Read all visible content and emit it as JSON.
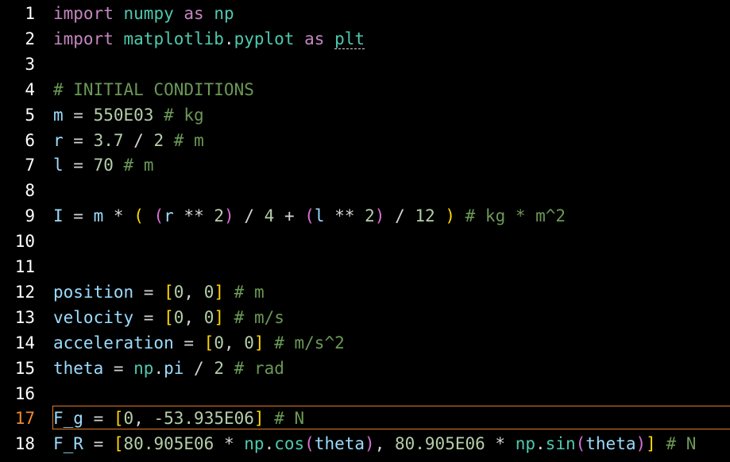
{
  "editor": {
    "language": "python",
    "active_line": 17,
    "colors": {
      "background": "#000000",
      "line_number": "#ffffff",
      "active_line_number": "#f08a30",
      "current_line_border": "#e07b2a",
      "keyword": "#c586c0",
      "module": "#4ec9b0",
      "variable": "#9cdcfe",
      "number": "#b5cea8",
      "comment": "#6a9955",
      "bracket_level1": "#ffd700",
      "bracket_level2": "#da70d6"
    },
    "lines": [
      {
        "n": "1",
        "tokens": [
          [
            "kw",
            "import"
          ],
          [
            "op",
            " "
          ],
          [
            "mod",
            "numpy"
          ],
          [
            "op",
            " "
          ],
          [
            "kw",
            "as"
          ],
          [
            "op",
            " "
          ],
          [
            "mod",
            "np"
          ]
        ]
      },
      {
        "n": "2",
        "tokens": [
          [
            "kw",
            "import"
          ],
          [
            "op",
            " "
          ],
          [
            "mod",
            "matplotlib"
          ],
          [
            "punc",
            "."
          ],
          [
            "mod",
            "pyplot"
          ],
          [
            "op",
            " "
          ],
          [
            "kw",
            "as"
          ],
          [
            "op",
            " "
          ],
          [
            "mod dotted",
            "plt"
          ]
        ]
      },
      {
        "n": "3",
        "tokens": []
      },
      {
        "n": "4",
        "tokens": [
          [
            "cmt",
            "# INITIAL CONDITIONS"
          ]
        ]
      },
      {
        "n": "5",
        "tokens": [
          [
            "var",
            "m"
          ],
          [
            "op",
            " = "
          ],
          [
            "num",
            "550E03"
          ],
          [
            "op",
            " "
          ],
          [
            "cmt",
            "# kg"
          ]
        ]
      },
      {
        "n": "6",
        "tokens": [
          [
            "var",
            "r"
          ],
          [
            "op",
            " = "
          ],
          [
            "num",
            "3.7"
          ],
          [
            "op",
            " / "
          ],
          [
            "num",
            "2"
          ],
          [
            "op",
            " "
          ],
          [
            "cmt",
            "# m"
          ]
        ]
      },
      {
        "n": "7",
        "tokens": [
          [
            "var",
            "l"
          ],
          [
            "op",
            " = "
          ],
          [
            "num",
            "70"
          ],
          [
            "op",
            " "
          ],
          [
            "cmt",
            "# m"
          ]
        ]
      },
      {
        "n": "8",
        "tokens": []
      },
      {
        "n": "9",
        "tokens": [
          [
            "var",
            "I"
          ],
          [
            "op",
            " = "
          ],
          [
            "var",
            "m"
          ],
          [
            "op",
            " * "
          ],
          [
            "b1",
            "("
          ],
          [
            "op",
            " "
          ],
          [
            "b2",
            "("
          ],
          [
            "var",
            "r"
          ],
          [
            "op",
            " ** "
          ],
          [
            "num",
            "2"
          ],
          [
            "b2",
            ")"
          ],
          [
            "op",
            " / "
          ],
          [
            "num",
            "4"
          ],
          [
            "op",
            " + "
          ],
          [
            "b2",
            "("
          ],
          [
            "var",
            "l"
          ],
          [
            "op",
            " ** "
          ],
          [
            "num",
            "2"
          ],
          [
            "b2",
            ")"
          ],
          [
            "op",
            " / "
          ],
          [
            "num",
            "12"
          ],
          [
            "op",
            " "
          ],
          [
            "b1",
            ")"
          ],
          [
            "op",
            " "
          ],
          [
            "cmt",
            "# kg * m^2"
          ]
        ]
      },
      {
        "n": "10",
        "tokens": []
      },
      {
        "n": "11",
        "tokens": []
      },
      {
        "n": "12",
        "tokens": [
          [
            "var",
            "position"
          ],
          [
            "op",
            " = "
          ],
          [
            "b1",
            "["
          ],
          [
            "num",
            "0"
          ],
          [
            "punc",
            ", "
          ],
          [
            "num",
            "0"
          ],
          [
            "b1",
            "]"
          ],
          [
            "op",
            " "
          ],
          [
            "cmt",
            "# m"
          ]
        ]
      },
      {
        "n": "13",
        "tokens": [
          [
            "var",
            "velocity"
          ],
          [
            "op",
            " = "
          ],
          [
            "b1",
            "["
          ],
          [
            "num",
            "0"
          ],
          [
            "punc",
            ", "
          ],
          [
            "num",
            "0"
          ],
          [
            "b1",
            "]"
          ],
          [
            "op",
            " "
          ],
          [
            "cmt",
            "# m/s"
          ]
        ]
      },
      {
        "n": "14",
        "tokens": [
          [
            "var",
            "acceleration"
          ],
          [
            "op",
            " = "
          ],
          [
            "b1",
            "["
          ],
          [
            "num",
            "0"
          ],
          [
            "punc",
            ", "
          ],
          [
            "num",
            "0"
          ],
          [
            "b1",
            "]"
          ],
          [
            "op",
            " "
          ],
          [
            "cmt",
            "# m/s^2"
          ]
        ]
      },
      {
        "n": "15",
        "tokens": [
          [
            "var",
            "theta"
          ],
          [
            "op",
            " = "
          ],
          [
            "mod",
            "np"
          ],
          [
            "punc",
            "."
          ],
          [
            "var",
            "pi"
          ],
          [
            "op",
            " / "
          ],
          [
            "num",
            "2"
          ],
          [
            "op",
            " "
          ],
          [
            "cmt",
            "# rad"
          ]
        ]
      },
      {
        "n": "16",
        "tokens": []
      },
      {
        "n": "17",
        "tokens": [
          [
            "var",
            "F_g"
          ],
          [
            "op",
            " = "
          ],
          [
            "b1",
            "["
          ],
          [
            "num",
            "0"
          ],
          [
            "punc",
            ", "
          ],
          [
            "num",
            "-53.935E06"
          ],
          [
            "b1",
            "]"
          ],
          [
            "op",
            " "
          ],
          [
            "cmt",
            "# N"
          ]
        ]
      },
      {
        "n": "18",
        "tokens": [
          [
            "var",
            "F_R"
          ],
          [
            "op",
            " = "
          ],
          [
            "b1",
            "["
          ],
          [
            "num",
            "80.905E06"
          ],
          [
            "op",
            " * "
          ],
          [
            "mod",
            "np"
          ],
          [
            "punc",
            "."
          ],
          [
            "fn",
            "cos"
          ],
          [
            "b2",
            "("
          ],
          [
            "var",
            "theta"
          ],
          [
            "b2",
            ")"
          ],
          [
            "punc",
            ", "
          ],
          [
            "num",
            "80.905E06"
          ],
          [
            "op",
            " * "
          ],
          [
            "mod",
            "np"
          ],
          [
            "punc",
            "."
          ],
          [
            "fn",
            "sin"
          ],
          [
            "b2",
            "("
          ],
          [
            "var",
            "theta"
          ],
          [
            "b2",
            ")"
          ],
          [
            "b1",
            "]"
          ],
          [
            "op",
            " "
          ],
          [
            "cmt",
            "# N"
          ]
        ]
      }
    ]
  }
}
